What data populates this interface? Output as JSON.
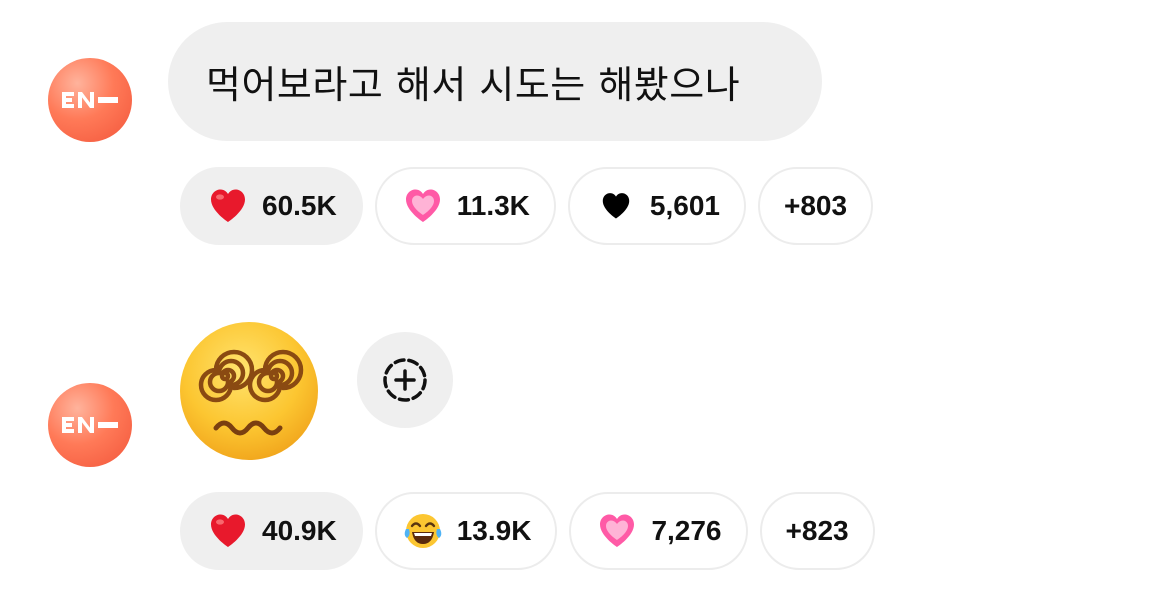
{
  "messages": [
    {
      "avatar_text": "EN-",
      "text": "먹어보라고 해서 시도는 해봤으나",
      "reactions": [
        {
          "icon": "red-heart-icon",
          "count": "60.5K",
          "active": true
        },
        {
          "icon": "pink-heart-icon",
          "count": "11.3K",
          "active": false
        },
        {
          "icon": "black-heart-icon",
          "count": "5,601",
          "active": false
        }
      ],
      "more": "+803"
    },
    {
      "avatar_text": "EN-",
      "emoji": "dizzy-spiral-face-emoji",
      "reactions": [
        {
          "icon": "red-heart-icon",
          "count": "40.9K",
          "active": true
        },
        {
          "icon": "laughing-tears-icon",
          "count": "13.9K",
          "active": false
        },
        {
          "icon": "pink-heart-icon",
          "count": "7,276",
          "active": false
        }
      ],
      "more": "+823"
    }
  ],
  "colors": {
    "avatar": "#f2553a",
    "bubble": "#efefef",
    "chip_border": "#ececec",
    "heart_red": "#e8192c",
    "heart_pink": "#ff6fb0"
  }
}
